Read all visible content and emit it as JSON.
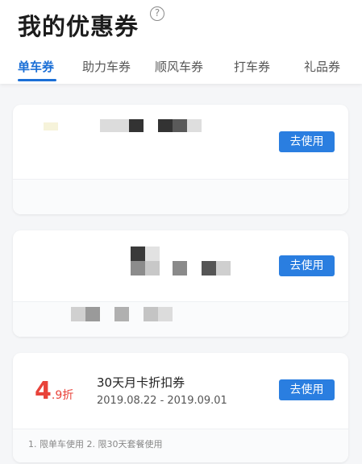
{
  "header": {
    "title": "我的优惠券",
    "help_icon": "?"
  },
  "tabs": [
    {
      "label": "单车券",
      "active": true
    },
    {
      "label": "助力车券",
      "active": false
    },
    {
      "label": "顺风车券",
      "active": false
    },
    {
      "label": "打车券",
      "active": false
    },
    {
      "label": "礼品券",
      "active": false
    }
  ],
  "coupons": [
    {
      "use_label": "去使用",
      "redacted": true
    },
    {
      "use_label": "去使用",
      "redacted": true
    },
    {
      "use_label": "去使用",
      "discount_main": "4",
      "discount_suffix": ".9折",
      "name": "30天月卡折扣券",
      "dates": "2019.08.22 - 2019.09.01",
      "note": "1. 限单车使用 2. 限30天套餐使用"
    }
  ],
  "colors": {
    "accent": "#1b6fd6",
    "button": "#2a7ee0",
    "discount": "#e8433a"
  }
}
